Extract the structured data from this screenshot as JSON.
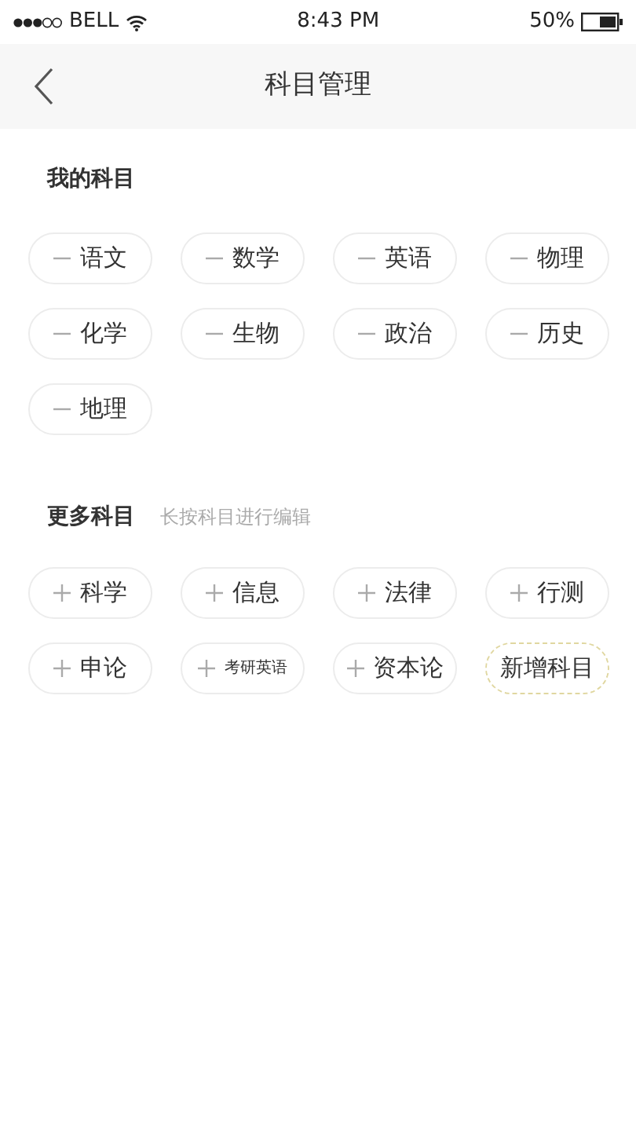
{
  "status_bar": {
    "carrier": "BELL",
    "time": "8:43 PM",
    "battery": "50%"
  },
  "nav": {
    "title": "科目管理"
  },
  "my_subjects": {
    "title": "我的科目",
    "items": [
      {
        "label": "语文",
        "kind": "remove"
      },
      {
        "label": "数学",
        "kind": "remove"
      },
      {
        "label": "英语",
        "kind": "remove"
      },
      {
        "label": "物理",
        "kind": "remove"
      },
      {
        "label": "化学",
        "kind": "remove"
      },
      {
        "label": "生物",
        "kind": "remove"
      },
      {
        "label": "政治",
        "kind": "remove"
      },
      {
        "label": "历史",
        "kind": "remove"
      },
      {
        "label": "地理",
        "kind": "remove"
      }
    ]
  },
  "more_subjects": {
    "title": "更多科目",
    "hint": "长按科目进行编辑",
    "items": [
      {
        "label": "科学",
        "kind": "add"
      },
      {
        "label": "信息",
        "kind": "add"
      },
      {
        "label": "法律",
        "kind": "add"
      },
      {
        "label": "行测",
        "kind": "add"
      },
      {
        "label": "申论",
        "kind": "add"
      },
      {
        "label": "考研英语",
        "kind": "add"
      },
      {
        "label": "资本论",
        "kind": "add"
      },
      {
        "label": "新增科目",
        "kind": "new"
      }
    ]
  }
}
